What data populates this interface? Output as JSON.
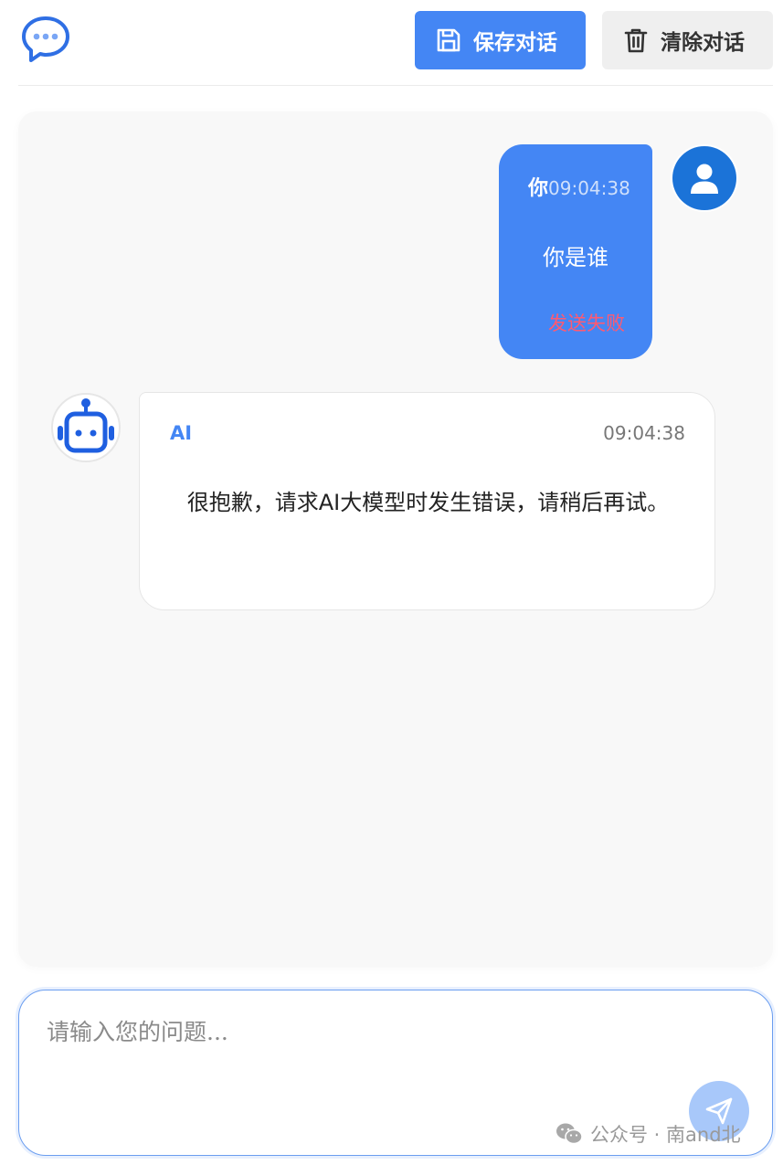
{
  "header": {
    "logo_icon": "chat-bubble-icon",
    "save_label": "保存对话",
    "clear_label": "清除对话",
    "save_icon": "floppy-disk-icon",
    "clear_icon": "trash-icon",
    "accent_color": "#4486f4"
  },
  "messages": [
    {
      "role": "user",
      "name": "你",
      "time": "09:04:38",
      "text": "你是谁",
      "status": "发送失败",
      "avatar_icon": "user-icon"
    },
    {
      "role": "ai",
      "name": "AI",
      "time": "09:04:38",
      "text": "很抱歉，请求AI大模型时发生错误，请稍后再试。",
      "avatar_icon": "robot-icon"
    }
  ],
  "input": {
    "placeholder": "请输入您的问题...",
    "value": "",
    "send_icon": "send-paper-plane-icon"
  },
  "watermark": {
    "text": "公众号 · 南and北",
    "icon": "wechat-icon"
  }
}
